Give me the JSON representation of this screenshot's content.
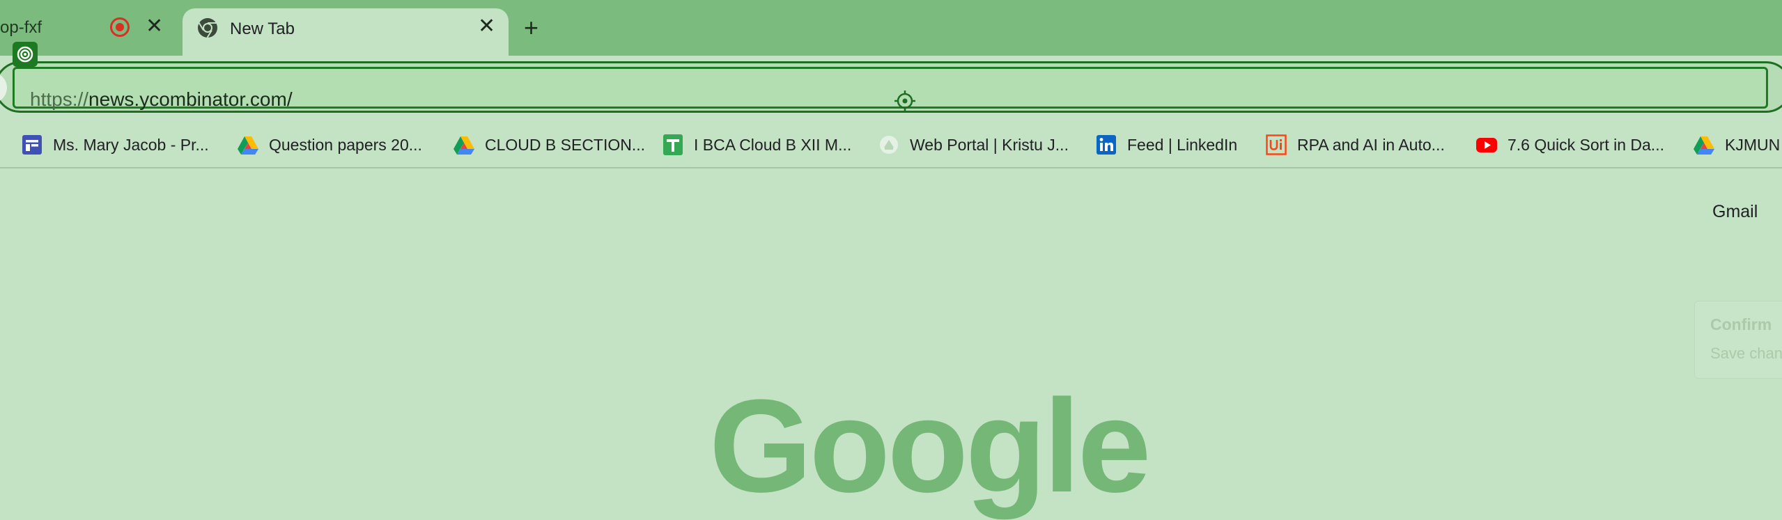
{
  "tabs": [
    {
      "title": "op-fxf",
      "active": false,
      "recording": true
    },
    {
      "title": "New Tab",
      "active": true
    }
  ],
  "new_tab_symbol": "+",
  "close_symbol": "✕",
  "omnibox": {
    "scheme": "https://",
    "host_path": "news.ycombinator.com/"
  },
  "bookmarks": [
    {
      "label": "Ms. Mary Jacob - Pr...",
      "icon": "google-forms-icon"
    },
    {
      "label": "Question papers 20...",
      "icon": "google-drive-icon"
    },
    {
      "label": "CLOUD B SECTION...",
      "icon": "google-drive-icon"
    },
    {
      "label": "I BCA Cloud B XII M...",
      "icon": "google-sheets-icon"
    },
    {
      "label": "Web Portal | Kristu J...",
      "icon": "portal-icon"
    },
    {
      "label": "Feed | LinkedIn",
      "icon": "linkedin-icon"
    },
    {
      "label": "RPA and AI in Auto...",
      "icon": "uipath-icon"
    },
    {
      "label": "7.6 Quick Sort in Da...",
      "icon": "youtube-icon"
    },
    {
      "label": "KJMUN",
      "icon": "google-drive-icon"
    }
  ],
  "content": {
    "gmail": "Gmail",
    "logo_text": "Google",
    "toast_title": "Confirm ",
    "toast_subtitle": "Save chan"
  },
  "colors": {
    "tabstrip": "#7bbb7e",
    "page_background": "#c4e2c4",
    "omnibox_focus_border": "#1f7a24",
    "recording_red": "#d93025"
  }
}
